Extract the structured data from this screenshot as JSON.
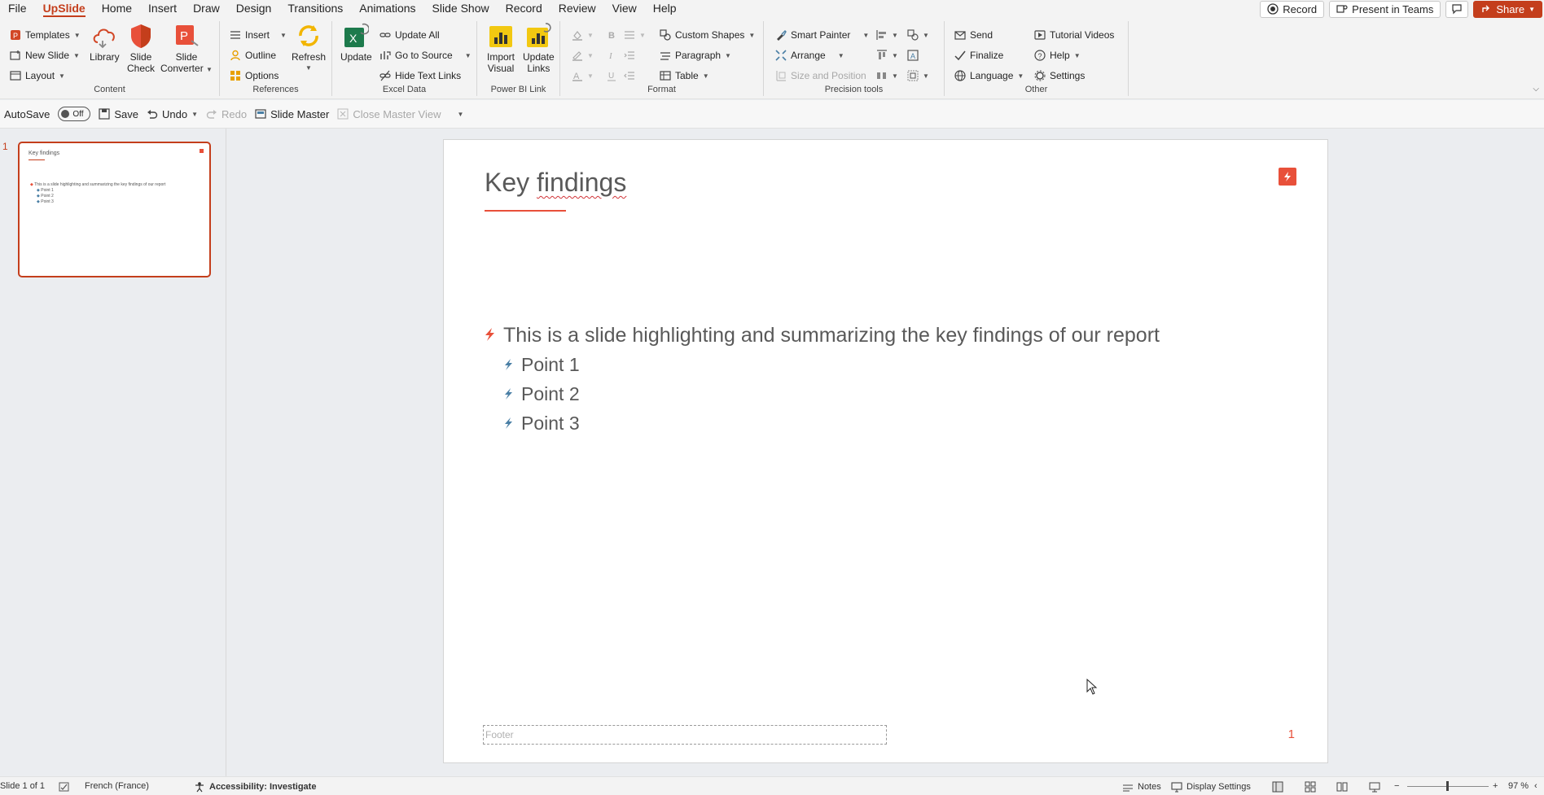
{
  "menu": {
    "tabs": [
      "File",
      "UpSlide",
      "Home",
      "Insert",
      "Draw",
      "Design",
      "Transitions",
      "Animations",
      "Slide Show",
      "Record",
      "Review",
      "View",
      "Help"
    ],
    "active_tab": "UpSlide",
    "record_label": "Record",
    "present_label": "Present in Teams",
    "share_label": "Share"
  },
  "ribbon": {
    "content": {
      "label": "Content",
      "templates": "Templates",
      "new_slide": "New Slide",
      "layout": "Layout",
      "library": "Library",
      "slide_check_1": "Slide",
      "slide_check_2": "Check",
      "slide_converter_1": "Slide",
      "slide_converter_2": "Converter"
    },
    "references": {
      "label": "References",
      "insert": "Insert",
      "outline": "Outline",
      "options": "Options",
      "refresh": "Refresh"
    },
    "excel": {
      "label": "Excel Data",
      "update": "Update",
      "update_all": "Update All",
      "go_to_source": "Go to Source",
      "hide_text_links": "Hide Text Links"
    },
    "powerbi": {
      "label": "Power BI Link",
      "import_1": "Import",
      "import_2": "Visual",
      "update_1": "Update",
      "update_2": "Links"
    },
    "format": {
      "label": "Format",
      "custom_shapes": "Custom Shapes",
      "paragraph": "Paragraph",
      "table": "Table"
    },
    "precision": {
      "label": "Precision tools",
      "smart_painter": "Smart Painter",
      "arrange": "Arrange",
      "size_position": "Size and Position"
    },
    "other": {
      "label": "Other",
      "send": "Send",
      "finalize": "Finalize",
      "language": "Language",
      "tutorial": "Tutorial Videos",
      "help": "Help",
      "settings": "Settings"
    }
  },
  "qat": {
    "autosave": "AutoSave",
    "toggle": "Off",
    "save": "Save",
    "undo": "Undo",
    "redo": "Redo",
    "slide_master": "Slide Master",
    "close_master": "Close Master View"
  },
  "thumbnail": {
    "number": "1",
    "title": "Key findings",
    "bullet": "This is a slide highlighting and summarizing the key findings of our report",
    "points": [
      "Point 1",
      "Point 2",
      "Point 3"
    ]
  },
  "slide": {
    "title_part1": "Key ",
    "title_part2": "findings",
    "bullet_main": "This is a slide highlighting and summarizing the key findings of our report",
    "points": [
      "Point 1",
      "Point 2",
      "Point 3"
    ],
    "footer": "Footer",
    "page_number": "1"
  },
  "status": {
    "slide_of": "Slide 1 of 1",
    "language": "French (France)",
    "accessibility": "Accessibility: Investigate",
    "notes": "Notes",
    "display_settings": "Display Settings",
    "zoom": "97 %"
  },
  "colors": {
    "accent": "#c43e1c",
    "brand_logo": "#e8503a",
    "sub_bullet": "#4a7fa5"
  }
}
